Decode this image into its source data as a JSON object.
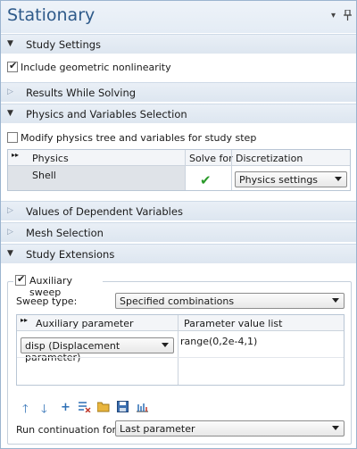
{
  "window": {
    "title": "Stationary",
    "menu_glyph": "▾",
    "pin_glyph": "⚲"
  },
  "sections": {
    "study_settings": "Study Settings",
    "results_while_solving": "Results While Solving",
    "physics_variables": "Physics and Variables Selection",
    "dependent_values": "Values of Dependent Variables",
    "mesh_selection": "Mesh Selection",
    "study_extensions": "Study Extensions"
  },
  "study_settings": {
    "geometric_nonlinearity_label": "Include geometric nonlinearity",
    "geometric_nonlinearity_checked": true
  },
  "physics": {
    "modify_tree_label": "Modify physics tree and variables for study step",
    "modify_tree_checked": false,
    "columns": {
      "physics": "Physics",
      "solve_for": "Solve for",
      "discretization": "Discretization"
    },
    "rows": [
      {
        "physics": "Shell",
        "solve_for": "✔",
        "discretization": "Physics settings"
      }
    ]
  },
  "extensions": {
    "aux_sweep_label": "Auxiliary sweep",
    "aux_sweep_checked": true,
    "sweep_type_label": "Sweep type:",
    "sweep_type_value": "Specified combinations",
    "columns": {
      "aux_param": "Auxiliary parameter",
      "value_list": "Parameter value list"
    },
    "rows": [
      {
        "param": "disp (Displacement parameter)",
        "value": "range(0,2e-4,1)"
      }
    ],
    "run_continuation_label": "Run continuation for:",
    "run_continuation_value": "Last parameter"
  },
  "toolbar_icons": [
    "move-up-icon",
    "move-down-icon",
    "add-icon",
    "clear-table-icon",
    "load-from-file-icon",
    "save-to-file-icon",
    "range-icon"
  ]
}
